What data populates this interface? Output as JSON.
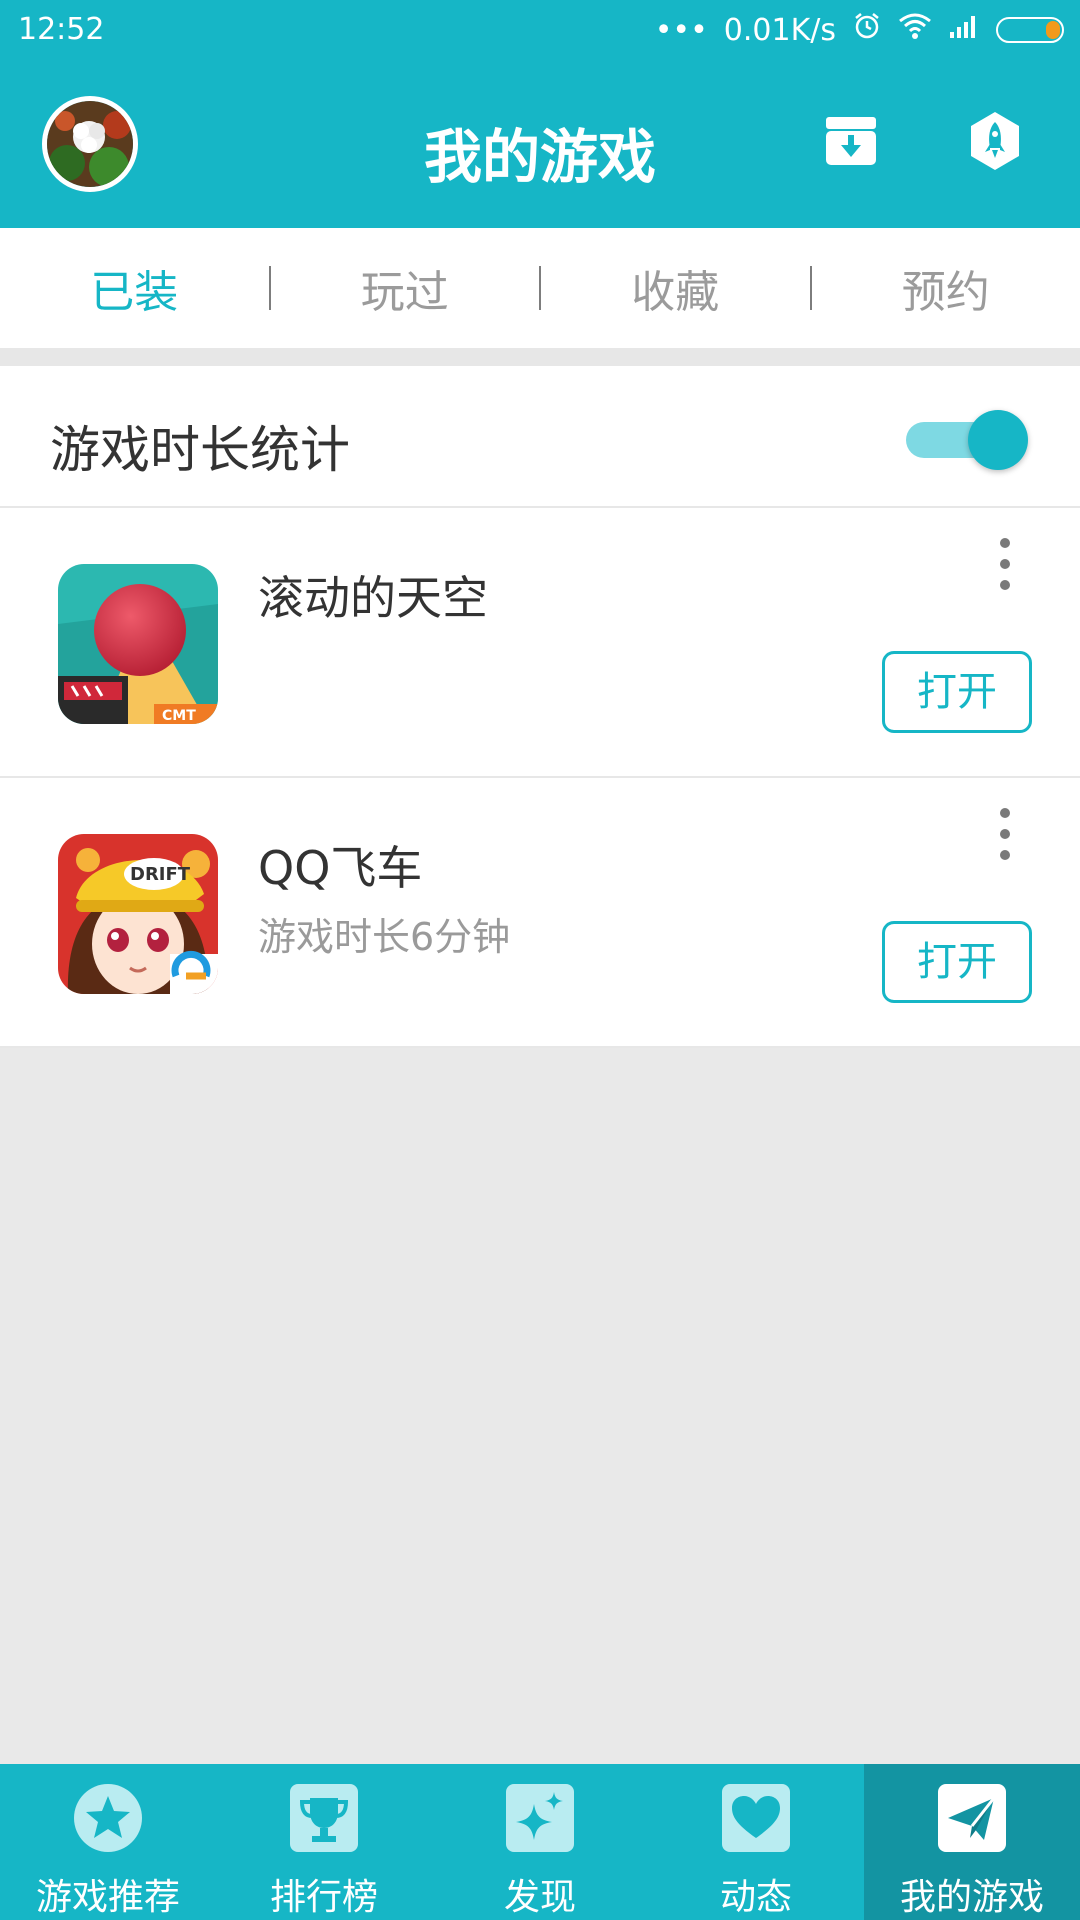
{
  "status_bar": {
    "time": "12:52",
    "dots": "•••",
    "net_speed": "0.01K/s",
    "battery_color": "#f39a1b"
  },
  "app_bar": {
    "title": "我的游戏",
    "download_icon": "download-box-icon",
    "rocket_icon": "rocket-icon",
    "background": "#16b6c6"
  },
  "tabs": [
    {
      "label": "已装",
      "active": true
    },
    {
      "label": "玩过",
      "active": false
    },
    {
      "label": "收藏",
      "active": false
    },
    {
      "label": "预约",
      "active": false
    }
  ],
  "settings": {
    "duration_stats_label": "游戏时长统计",
    "duration_stats_on": true
  },
  "games": [
    {
      "name": "滚动的天空",
      "subtitle": "",
      "action": "打开"
    },
    {
      "name": "QQ飞车",
      "subtitle": "游戏时长6分钟",
      "action": "打开"
    }
  ],
  "bottom_nav": [
    {
      "label": "游戏推荐",
      "icon": "star-icon",
      "active": false
    },
    {
      "label": "排行榜",
      "icon": "trophy-icon",
      "active": false
    },
    {
      "label": "发现",
      "icon": "sparkle-icon",
      "active": false
    },
    {
      "label": "动态",
      "icon": "heart-icon",
      "active": false
    },
    {
      "label": "我的游戏",
      "icon": "paper-plane-icon",
      "active": true
    }
  ]
}
